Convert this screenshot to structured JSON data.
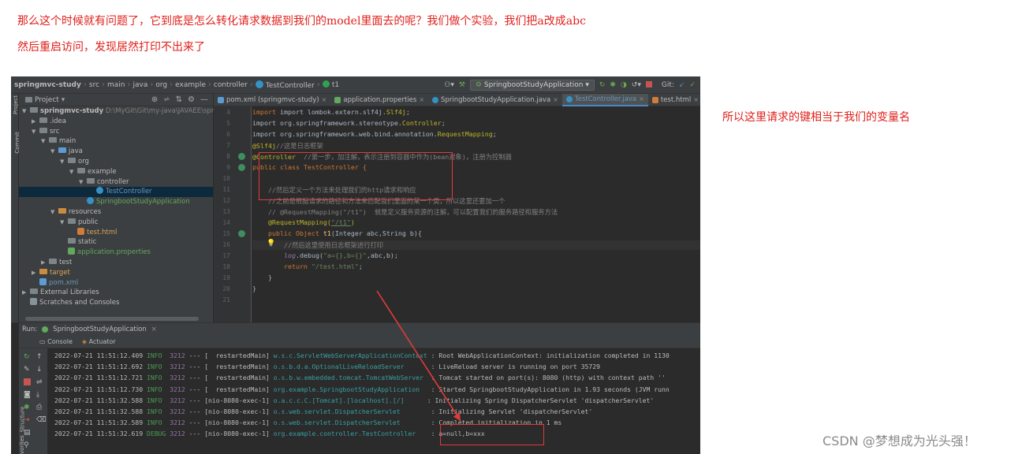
{
  "notes": {
    "line1": "那么这个时候就有问题了，它到底是怎么转化请求数据到我们的model里面去的呢？我们做个实验，我们把a改成abc",
    "line2": "然后重启访问，发现居然打印不出来了",
    "side": "所以这里请求的键相当于我们的变量名"
  },
  "watermark": "CSDN @梦想成为光头强！",
  "ide": {
    "breadcrumbs": [
      "springmvc-study",
      "src",
      "main",
      "java",
      "org",
      "example",
      "controller",
      "TestController",
      "t1"
    ],
    "run_config": "SpringbootStudyApplication",
    "git_label": "Git:",
    "colors": {
      "accent": "#4a88c7",
      "editor_bg": "#2b2b2b",
      "panel_bg": "#3c3f41",
      "annotation_red": "#e23a3a"
    },
    "left_strip_labels": [
      "Project",
      "Commit"
    ],
    "project": {
      "title": "Project",
      "root_name": "springmvc-study",
      "root_path": "D:\\MyGit\\Git\\my-java\\JAVAEE\\springmv",
      "tree": [
        {
          "label": "springmvc-study",
          "depth": 0,
          "open": true
        },
        {
          "label": ".idea",
          "depth": 1,
          "open": false
        },
        {
          "label": "src",
          "depth": 1,
          "open": true
        },
        {
          "label": "main",
          "depth": 2,
          "open": true
        },
        {
          "label": "java",
          "depth": 3,
          "open": true
        },
        {
          "label": "org",
          "depth": 4,
          "open": true
        },
        {
          "label": "example",
          "depth": 5,
          "open": true
        },
        {
          "label": "controller",
          "depth": 6,
          "open": true
        },
        {
          "label": "TestController",
          "depth": 7,
          "selected": true
        },
        {
          "label": "SpringbootStudyApplication",
          "depth": 6
        },
        {
          "label": "resources",
          "depth": 3,
          "open": true
        },
        {
          "label": "public",
          "depth": 4,
          "open": true
        },
        {
          "label": "test.html",
          "depth": 5
        },
        {
          "label": "static",
          "depth": 4
        },
        {
          "label": "application.properties",
          "depth": 4
        },
        {
          "label": "test",
          "depth": 2,
          "open": false
        },
        {
          "label": "target",
          "depth": 1,
          "open": false
        },
        {
          "label": "pom.xml",
          "depth": 1
        },
        {
          "label": "External Libraries",
          "depth": 0,
          "open": false
        },
        {
          "label": "Scratches and Consoles",
          "depth": 0
        }
      ]
    },
    "tabs": [
      {
        "label": "pom.xml (springmvc-study)",
        "active": false
      },
      {
        "label": "application.properties",
        "active": false
      },
      {
        "label": "SpringbootStudyApplication.java",
        "active": false
      },
      {
        "label": "TestController.java",
        "active": true
      },
      {
        "label": "test.html",
        "active": false
      }
    ],
    "line_numbers": [
      "4",
      "5",
      "6",
      "7",
      "8",
      "9",
      "10",
      "11",
      "12",
      "13",
      "14",
      "15",
      "16",
      "17",
      "18",
      "19",
      "20",
      "21"
    ],
    "code": {
      "l4": "import lombok.extern.slf4j.",
      "l4b": "Slf4j",
      "l4c": ";",
      "l5": "import org.springframework.stereotype.",
      "l5b": "Controller",
      "l6": "import org.springframework.web.bind.annotation.",
      "l6b": "RequestMapping",
      "l7a": "@Slf4j",
      "l7b": "//这是日志框架",
      "l8a": "@Controller",
      "l8b": "  //第一步，加注解，表示注册到容器中作为(bean对象)，注册为控制器",
      "l9": "public class TestController {",
      "l11": "    //然后定义一个方法来处理我们的http请求和响应",
      "l12": "    //之前是根据请求的路径和方法来匹配我们里面的某一个类，所以这里还要加一个",
      "l13": "    // @RequestMapping(\"/t1\")  就是定义服务资源的注解，可以配置我们的服务路径和服务方法",
      "l14a": "    @RequestMapping(",
      "l14b": "\"/t1\"",
      "l14c": ")",
      "l15a": "    public Object ",
      "l15b": "t1",
      "l15c": "(Integer abc,String b){",
      "l16": "        //然后这里使用日志框架进行打印",
      "l17a": "        ",
      "l17b": "log",
      "l17c": ".debug(",
      "l17d": "\"a={},b={}\"",
      "l17e": ",abc,b);",
      "l18a": "        return ",
      "l18b": "\"/test.html\"",
      "l18c": ";",
      "l19": "    }",
      "l20": "}"
    },
    "run": {
      "label": "Run:",
      "config": "SpringbootStudyApplication",
      "tab_console": "Console",
      "tab_actuator": "Actuator",
      "side_labels": [
        "Structure",
        "Favorites"
      ],
      "logs": [
        {
          "ts": "2022-07-21 11:51:12.409",
          "level": "INFO ",
          "pid": "3212",
          "thread": "--- [  restartedMain]",
          "logger": "w.s.c.ServletWebServerApplicationContext",
          "msg": ": Root WebApplicationContext: initialization completed in 1130"
        },
        {
          "ts": "2022-07-21 11:51:12.692",
          "level": "INFO ",
          "pid": "3212",
          "thread": "--- [  restartedMain]",
          "logger": "o.s.b.d.a.OptionalLiveReloadServer      ",
          "msg": ": LiveReload server is running on port 35729"
        },
        {
          "ts": "2022-07-21 11:51:12.721",
          "level": "INFO ",
          "pid": "3212",
          "thread": "--- [  restartedMain]",
          "logger": "o.s.b.w.embedded.tomcat.TomcatWebServer ",
          "msg": ": Tomcat started on port(s): 8080 (http) with context path ''"
        },
        {
          "ts": "2022-07-21 11:51:12.730",
          "level": "INFO ",
          "pid": "3212",
          "thread": "--- [  restartedMain]",
          "logger": "org.example.SpringbootStudyApplication  ",
          "msg": ": Started SpringbootStudyApplication in 1.93 seconds (JVM runn"
        },
        {
          "ts": "2022-07-21 11:51:32.588",
          "level": "INFO ",
          "pid": "3212",
          "thread": "--- [nio-8080-exec-1]",
          "logger": "o.a.c.c.C.[Tomcat].[localhost].[/]     ",
          "msg": ": Initializing Spring DispatcherServlet 'dispatcherServlet'"
        },
        {
          "ts": "2022-07-21 11:51:32.588",
          "level": "INFO ",
          "pid": "3212",
          "thread": "--- [nio-8080-exec-1]",
          "logger": "o.s.web.servlet.DispatcherServlet       ",
          "msg": ": Initializing Servlet 'dispatcherServlet'"
        },
        {
          "ts": "2022-07-21 11:51:32.589",
          "level": "INFO ",
          "pid": "3212",
          "thread": "--- [nio-8080-exec-1]",
          "logger": "o.s.web.servlet.DispatcherServlet       ",
          "msg": ": Completed initialization in 1 ms"
        },
        {
          "ts": "2022-07-21 11:51:32.619",
          "level": "DEBUG",
          "pid": "3212",
          "thread": "--- [nio-8080-exec-1]",
          "logger": "org.example.controller.TestController   ",
          "msg": ": a=null,b=xxx"
        }
      ]
    }
  }
}
